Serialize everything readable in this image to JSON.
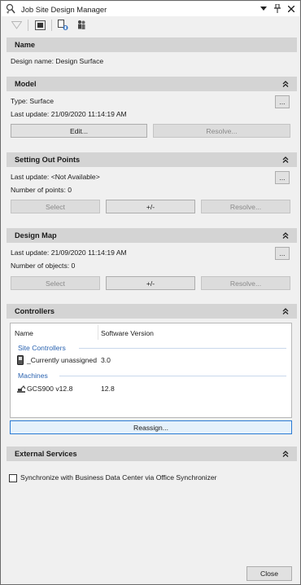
{
  "window": {
    "title": "Job Site Design Manager"
  },
  "name_section": {
    "header": "Name",
    "design_name": "Design name: Design Surface"
  },
  "model_section": {
    "header": "Model",
    "type_line": "Type: Surface",
    "last_update": "Last update: 21/09/2020 11:14:19 AM",
    "more_label": "...",
    "edit_label": "Edit...",
    "resolve_label": "Resolve..."
  },
  "setting_out_section": {
    "header": "Setting Out Points",
    "last_update": "Last update: <Not Available>",
    "count": "Number of points: 0",
    "more_label": "...",
    "select_label": "Select",
    "plusminus_label": "+/-",
    "resolve_label": "Resolve..."
  },
  "design_map_section": {
    "header": "Design Map",
    "last_update": "Last update: 21/09/2020 11:14:19 AM",
    "count": "Number of objects: 0",
    "more_label": "...",
    "select_label": "Select",
    "plusminus_label": "+/-",
    "resolve_label": "Resolve..."
  },
  "controllers_section": {
    "header": "Controllers",
    "columns": {
      "name": "Name",
      "version": "Software Version"
    },
    "groups": [
      {
        "label": "Site Controllers",
        "rows": [
          {
            "name": "_Currently unassigned",
            "version": "3.0",
            "icon": "handheld-controller-icon"
          }
        ]
      },
      {
        "label": "Machines",
        "rows": [
          {
            "name": "GCS900 v12.8",
            "version": "12.8",
            "icon": "excavator-icon"
          }
        ]
      }
    ],
    "reassign_label": "Reassign..."
  },
  "external_services_section": {
    "header": "External Services",
    "sync_label": "Synchronize with Business Data Center via Office Synchronizer",
    "sync_checked": false
  },
  "footer": {
    "close_label": "Close"
  },
  "colors": {
    "header_bg": "#d4d4d4",
    "group_label": "#2a63b0",
    "accent_border": "#2a7bd4"
  }
}
